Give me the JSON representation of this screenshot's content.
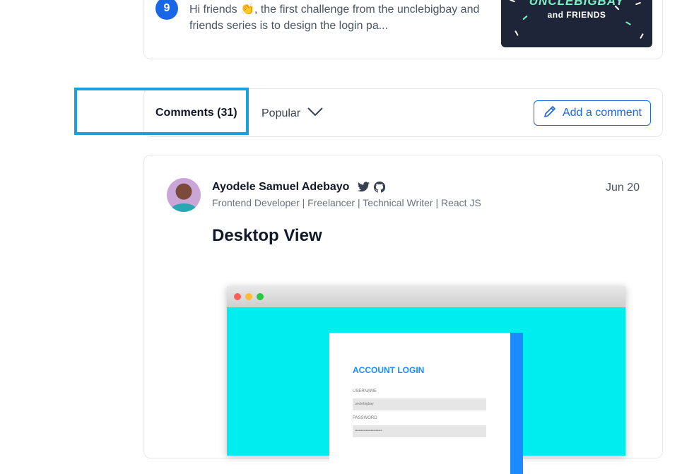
{
  "article": {
    "number": "9",
    "excerpt": "Hi friends 👏, the first challenge from the unclebigbay and friends series is to design the login pa...",
    "thumbnail_title": "UNCLEBIGBAY",
    "thumbnail_subtitle": "and FRIENDS"
  },
  "comments_bar": {
    "tab_label": "Comments (31)",
    "sort_label": "Popular",
    "add_comment_label": "Add a comment",
    "highlight_color": "#1a9fdf"
  },
  "comment": {
    "author": "Ayodele Samuel Adebayo",
    "bio": "Frontend Developer | Freelancer | Technical Writer | React JS",
    "date": "Jun 20",
    "heading": "Desktop View",
    "social_icons": [
      "twitter-icon",
      "github-icon"
    ]
  },
  "mockup": {
    "login_title": "ACCOUNT LOGIN",
    "username_label": "USERNAME",
    "username_value": "unclebigbay",
    "password_label": "PASSWORD",
    "password_value": "••••••••••••••••••••••"
  },
  "colors": {
    "accent": "#1967e6",
    "mockup_bg": "#00edef",
    "login_accent": "#1a8cff"
  }
}
